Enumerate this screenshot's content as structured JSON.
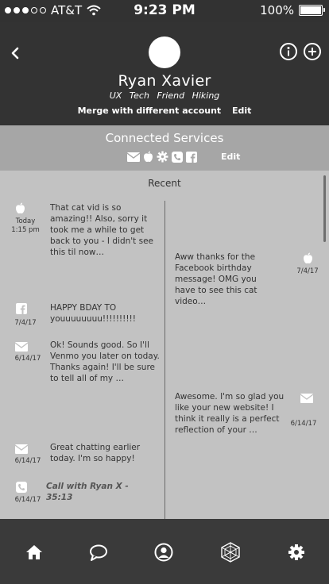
{
  "status_bar": {
    "carrier": "AT&T",
    "time": "9:23 PM",
    "battery": "100%"
  },
  "header": {
    "name": "Ryan Xavier",
    "tags": [
      "UX",
      "Tech",
      "Friend",
      "Hiking"
    ],
    "merge_label": "Merge with different account",
    "edit_label": "Edit",
    "info_icon": "info-icon",
    "add_icon": "plus-icon"
  },
  "services": {
    "title": "Connected Services",
    "edit_label": "Edit",
    "icons": [
      "mail-icon",
      "apple-icon",
      "gear-icon",
      "phone-icon",
      "facebook-icon"
    ]
  },
  "timeline": {
    "section_label": "Recent",
    "entries": [
      {
        "side": "left",
        "icon": "apple-icon",
        "date_line1": "Today",
        "date_line2": "1:15 pm",
        "text": "That cat vid is so amazing!! Also, sorry it took me a while to get back to you - I didn't see this til now…"
      },
      {
        "side": "right",
        "icon": "apple-icon",
        "date_line1": "7/4/17",
        "date_line2": "",
        "text": "Aww thanks for the Facebook birthday message! OMG you have to see this cat video…"
      },
      {
        "side": "left",
        "icon": "facebook-icon",
        "date_line1": "7/4/17",
        "date_line2": "",
        "text": "HAPPY BDAY TO youuuuuuuu!!!!!!!!!!"
      },
      {
        "side": "left",
        "icon": "mail-icon",
        "date_line1": "6/14/17",
        "date_line2": "",
        "text": "Ok! Sounds good. So I'll Venmo you later on today. Thanks again! I'll be sure to tell all of my …"
      },
      {
        "side": "right",
        "icon": "mail-icon",
        "date_line1": "6/14/17",
        "date_line2": "",
        "text": "Awesome. I'm so glad you like your new website! I think it really is a perfect reflection of your …"
      },
      {
        "side": "left",
        "icon": "mail-icon",
        "date_line1": "6/14/17",
        "date_line2": "",
        "text": "Great chatting earlier today. I'm so happy!"
      },
      {
        "side": "left",
        "icon": "phone-icon",
        "date_line1": "6/14/17",
        "date_line2": "",
        "text": "Call with Ryan X - 35:13"
      }
    ]
  },
  "nav": {
    "items": [
      "home-icon",
      "chat-icon",
      "profile-icon",
      "network-icon",
      "settings-icon"
    ]
  }
}
